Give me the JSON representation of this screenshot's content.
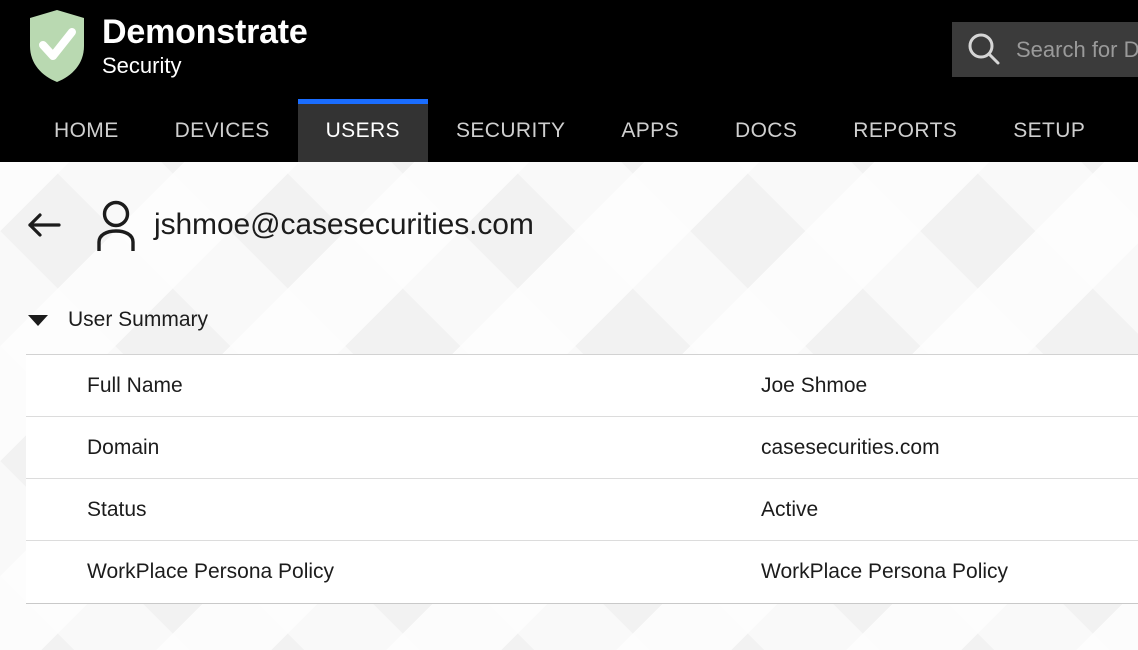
{
  "brand": {
    "title": "Demonstrate",
    "subtitle": "Security",
    "logo_icon": "shield-check-icon",
    "logo_color": "#b9d9b1"
  },
  "search": {
    "icon": "search-icon",
    "value": "",
    "placeholder": "Search for D"
  },
  "nav": {
    "active_accent_color": "#1a6dff",
    "active_tab_bg": "#333333",
    "items": [
      {
        "label": "HOME",
        "active": false
      },
      {
        "label": "DEVICES",
        "active": false
      },
      {
        "label": "USERS",
        "active": true
      },
      {
        "label": "SECURITY",
        "active": false
      },
      {
        "label": "APPS",
        "active": false
      },
      {
        "label": "DOCS",
        "active": false
      },
      {
        "label": "REPORTS",
        "active": false
      },
      {
        "label": "SETUP",
        "active": false
      }
    ]
  },
  "page": {
    "back_icon": "arrow-left-icon",
    "avatar_icon": "user-icon",
    "title": "jshmoe@casesecurities.com"
  },
  "section": {
    "caret_icon": "chevron-down-icon",
    "title": "User Summary",
    "expanded": true
  },
  "summary": {
    "rows": [
      {
        "label": "Full Name",
        "value": "Joe Shmoe"
      },
      {
        "label": "Domain",
        "value": "casesecurities.com"
      },
      {
        "label": "Status",
        "value": "Active"
      },
      {
        "label": "WorkPlace Persona Policy",
        "value": "WorkPlace Persona Policy"
      }
    ]
  }
}
